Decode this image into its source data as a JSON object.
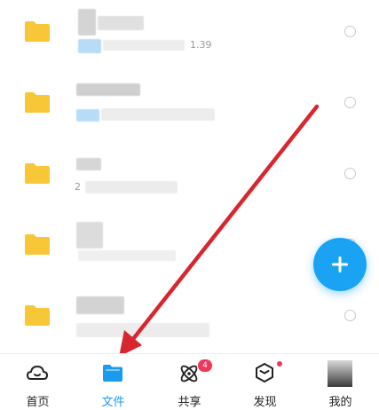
{
  "file_rows": [
    {
      "text": "1.39"
    },
    {
      "text": ""
    },
    {
      "text": "2"
    },
    {
      "text": ""
    },
    {
      "text": ""
    }
  ],
  "colors": {
    "accent": "#1b9bf0",
    "folder": "#f7c737",
    "fab": "#1aa3f2",
    "badge": "#f0375a",
    "annotation_arrow": "#d8262f"
  },
  "fab": {
    "icon": "plus-icon"
  },
  "tabbar": {
    "tabs": [
      {
        "label": "首页",
        "icon": "home-cloud-icon"
      },
      {
        "label": "文件",
        "icon": "folder-icon",
        "active": true
      },
      {
        "label": "共享",
        "icon": "atom-share-icon",
        "badge": "4"
      },
      {
        "label": "发现",
        "icon": "cube-discover-icon",
        "dot": true
      },
      {
        "label": "我的",
        "icon": "avatar"
      }
    ]
  }
}
